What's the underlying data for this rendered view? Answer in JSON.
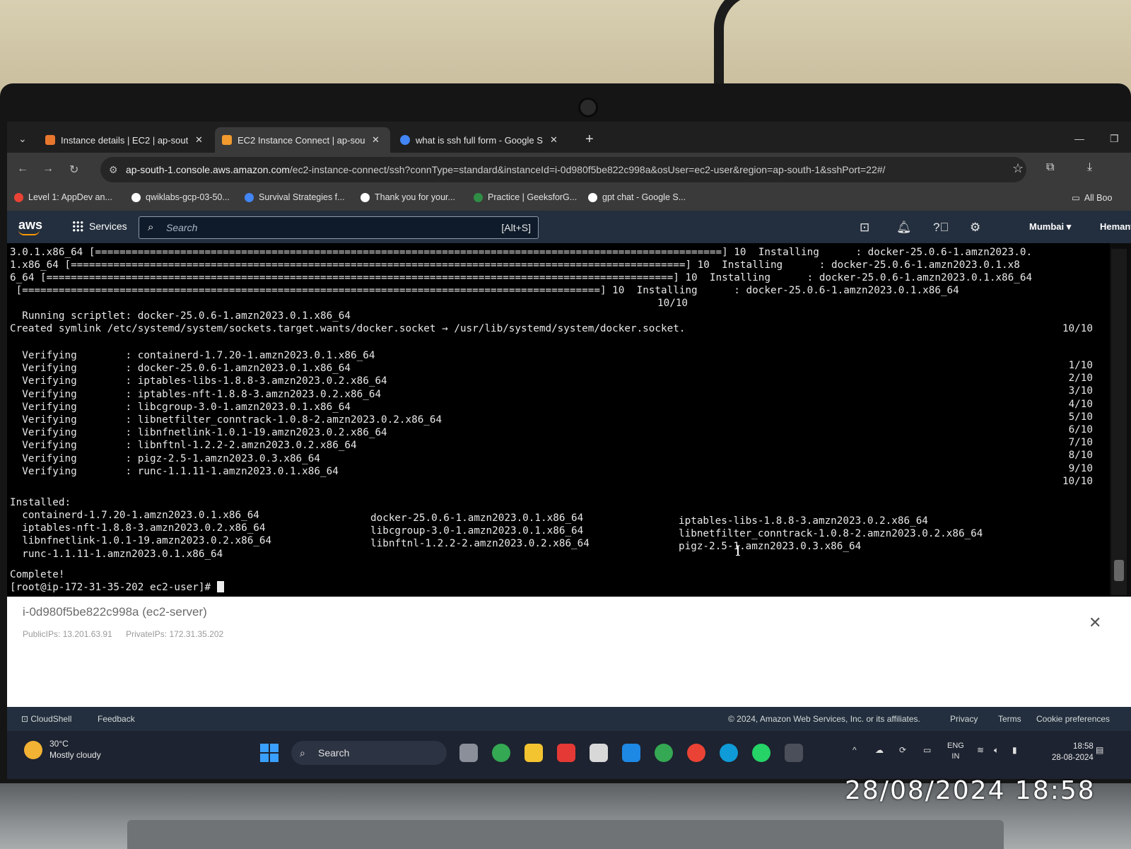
{
  "browser": {
    "tabs": [
      {
        "label": "Instance details | EC2 | ap-sout",
        "active": false,
        "favicon_color": "#e8772e"
      },
      {
        "label": "EC2 Instance Connect | ap-sout",
        "active": true,
        "favicon_color": "#f29a2e"
      },
      {
        "label": "what is ssh full form - Google S",
        "active": false,
        "favicon_color": "#4285f4"
      }
    ],
    "url_host": "ap-south-1.console.aws.amazon.com",
    "url_path": "/ec2-instance-connect/ssh?connType=standard&instanceId=i-0d980f5be822c998a&osUser=ec2-user&region=ap-south-1&sshPort=22#/",
    "bookmarks": [
      {
        "label": "Level 1: AppDev an...",
        "icon_color": "#ea4335"
      },
      {
        "label": "qwiklabs-gcp-03-50...",
        "icon_color": "#ffffff"
      },
      {
        "label": "Survival Strategies f...",
        "icon_color": "#4285f4"
      },
      {
        "label": "Thank you for your...",
        "icon_color": "#ffffff"
      },
      {
        "label": "Practice | GeeksforG...",
        "icon_color": "#2f8d46"
      },
      {
        "label": "gpt chat - Google S...",
        "icon_color": "#ffffff"
      }
    ],
    "all_bookmarks": "All Boo"
  },
  "aws_nav": {
    "logo": "aws",
    "services": "Services",
    "search_placeholder": "Search",
    "search_shortcut": "[Alt+S]",
    "region": "Mumbai ▾",
    "user": "Hemanth"
  },
  "terminal": {
    "progress_lines": [
      {
        "left": "3.0.1.x86_64 [",
        "bar": "=======================================================================================================",
        "right": "] 10  Installing      : docker-25.0.6-1.amzn2023.0."
      },
      {
        "left": "1.x86_64 [",
        "bar": "=====================================================================================================",
        "right": "] 10  Installing      : docker-25.0.6-1.amzn2023.0.1.x8"
      },
      {
        "left": "6_64 [",
        "bar": "=======================================================================================================",
        "right": "] 10  Installing      : docker-25.0.6-1.amzn2023.0.1.x86_64"
      },
      {
        "left": " [",
        "bar": "===============================================================================================",
        "right": "] 10  Installing      : docker-25.0.6-1.amzn2023.0.1.x86_64"
      }
    ],
    "count_1010_a": "10/10",
    "scriptlet": "  Running scriptlet: docker-25.0.6-1.amzn2023.0.1.x86_64",
    "symlink": "Created symlink /etc/systemd/system/sockets.target.wants/docker.socket → /usr/lib/systemd/system/docker.socket.",
    "count_1010_b": "10/10",
    "verifying": [
      {
        "label": "  Verifying        : containerd-1.7.20-1.amzn2023.0.1.x86_64",
        "count": "1/10"
      },
      {
        "label": "  Verifying        : docker-25.0.6-1.amzn2023.0.1.x86_64",
        "count": "2/10"
      },
      {
        "label": "  Verifying        : iptables-libs-1.8.8-3.amzn2023.0.2.x86_64",
        "count": "3/10"
      },
      {
        "label": "  Verifying        : iptables-nft-1.8.8-3.amzn2023.0.2.x86_64",
        "count": "4/10"
      },
      {
        "label": "  Verifying        : libcgroup-3.0-1.amzn2023.0.1.x86_64",
        "count": "5/10"
      },
      {
        "label": "  Verifying        : libnetfilter_conntrack-1.0.8-2.amzn2023.0.2.x86_64",
        "count": "6/10"
      },
      {
        "label": "  Verifying        : libnfnetlink-1.0.1-19.amzn2023.0.2.x86_64",
        "count": "7/10"
      },
      {
        "label": "  Verifying        : libnftnl-1.2.2-2.amzn2023.0.2.x86_64",
        "count": "8/10"
      },
      {
        "label": "  Verifying        : pigz-2.5-1.amzn2023.0.3.x86_64",
        "count": "9/10"
      },
      {
        "label": "  Verifying        : runc-1.1.11-1.amzn2023.0.1.x86_64",
        "count": "10/10"
      }
    ],
    "installed_header": "Installed:",
    "installed_col1": [
      "  containerd-1.7.20-1.amzn2023.0.1.x86_64",
      "  iptables-nft-1.8.8-3.amzn2023.0.2.x86_64",
      "  libnfnetlink-1.0.1-19.amzn2023.0.2.x86_64",
      "  runc-1.1.11-1.amzn2023.0.1.x86_64"
    ],
    "installed_col2": [
      "docker-25.0.6-1.amzn2023.0.1.x86_64",
      "libcgroup-3.0-1.amzn2023.0.1.x86_64",
      "libnftnl-1.2.2-2.amzn2023.0.2.x86_64"
    ],
    "installed_col3": [
      "iptables-libs-1.8.8-3.amzn2023.0.2.x86_64",
      "libnetfilter_conntrack-1.0.8-2.amzn2023.0.2.x86_64",
      "pigz-2.5-1.amzn2023.0.3.x86_64"
    ],
    "complete": "Complete!",
    "prompt": "[root@ip-172-31-35-202 ec2-user]# "
  },
  "instance": {
    "id": "i-0d980f5be822c998a (ec2-server)",
    "public_ips": "PublicIPs: 13.201.63.91",
    "private_ips": "PrivateIPs: 172.31.35.202"
  },
  "footer": {
    "cloudshell": "CloudShell",
    "feedback": "Feedback",
    "copyright": "© 2024, Amazon Web Services, Inc. or its affiliates.",
    "privacy": "Privacy",
    "terms": "Terms",
    "cookies": "Cookie preferences"
  },
  "taskbar": {
    "weather_temp": "30°C",
    "weather_desc": "Mostly cloudy",
    "search": "Search",
    "lang": "ENG",
    "lang_region": "IN",
    "time": "18:58",
    "date": "28-08-2024"
  },
  "photo_timestamp": "28/08/2024 18:58"
}
